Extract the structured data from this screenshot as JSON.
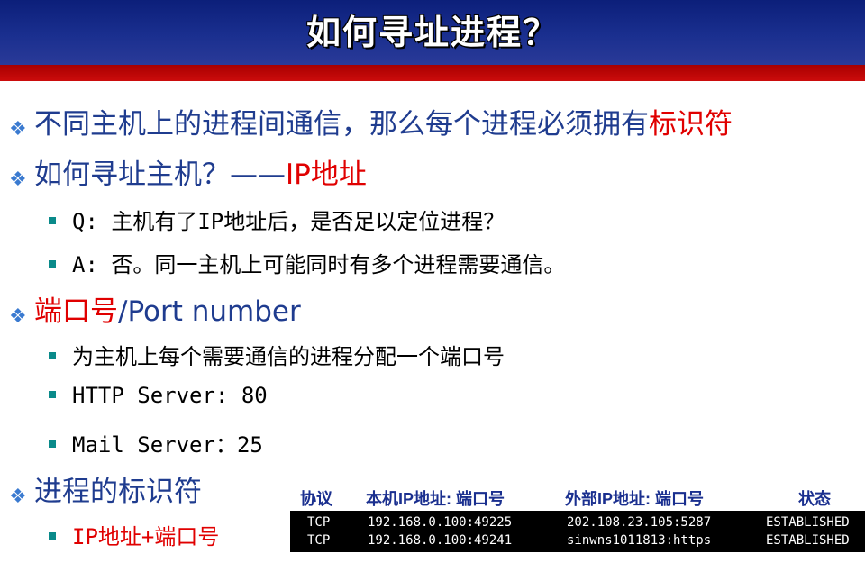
{
  "title": "如何寻址进程？",
  "bullets": {
    "b1": {
      "text": "不同主机上的进程间通信，那么每个进程必须拥有",
      "highlight": "标识符"
    },
    "b2": {
      "text": "如何寻址主机？——",
      "highlight": "IP地址"
    },
    "q": "Q: 主机有了IP地址后，是否足以定位进程？",
    "a": "A: 否。同一主机上可能同时有多个进程需要通信。",
    "b3": {
      "highlight": "端口号",
      "text": "/Port number"
    },
    "p1": "为主机上每个需要通信的进程分配一个端口号",
    "p2": "HTTP Server: 80",
    "p3": "Mail Server：25",
    "b4": {
      "text": "进程的标识符"
    },
    "p4": "IP地址+端口号"
  },
  "netstat": {
    "headers": [
      "协议",
      "本机IP地址: 端口号",
      "外部IP地址: 端口号",
      "状态"
    ],
    "rows": [
      [
        "TCP",
        "192.168.0.100:49225",
        "202.108.23.105:5287",
        "ESTABLISHED"
      ],
      [
        "TCP",
        "192.168.0.100:49241",
        "sinwns1011813:https",
        "ESTABLISHED"
      ]
    ]
  },
  "colors": {
    "title_bg": "#1a2f8f",
    "stripe": "#c00000",
    "text_blue": "#1f3c8f",
    "highlight_red": "#e00000",
    "bullet_teal": "#0a8a8a"
  },
  "icons": {
    "level1": "diamond-bullet-icon",
    "level2": "square-bullet-icon"
  }
}
